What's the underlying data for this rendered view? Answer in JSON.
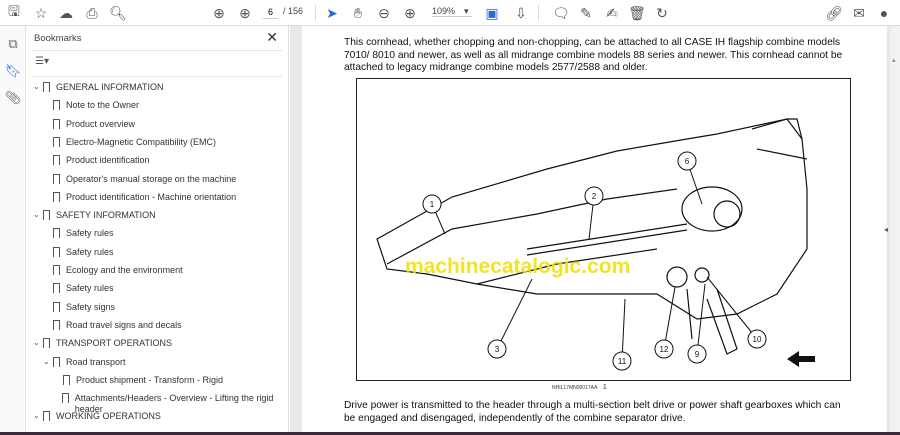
{
  "toolbar": {
    "page_current": "6",
    "page_total": "/ 156",
    "zoom": "109%",
    "icons": [
      "save-icon",
      "bookmark-star-icon",
      "upload-cloud-icon",
      "print-icon",
      "find-icon",
      "prev-page-icon",
      "next-page-icon",
      "select-cursor-icon",
      "hand-icon",
      "zoom-out-icon",
      "zoom-in-icon",
      "fit-page-icon",
      "scroll-mode-icon",
      "comment-icon",
      "highlight-icon",
      "sign-icon",
      "delete-icon",
      "rotate-icon",
      "share-link-icon",
      "email-icon",
      "account-icon"
    ]
  },
  "bookmarks": {
    "title": "Bookmarks",
    "close": "✕",
    "items": [
      {
        "label": "GENERAL INFORMATION",
        "level": 0,
        "expanded": true
      },
      {
        "label": "Note to the Owner",
        "level": 1
      },
      {
        "label": "Product overview",
        "level": 1
      },
      {
        "label": "Electro-Magnetic Compatibility (EMC)",
        "level": 1
      },
      {
        "label": "Product identification",
        "level": 1
      },
      {
        "label": "Operator's manual storage on the machine",
        "level": 1
      },
      {
        "label": "Product identification - Machine orientation",
        "level": 1
      },
      {
        "label": "SAFETY INFORMATION",
        "level": 0,
        "expanded": true
      },
      {
        "label": "Safety rules",
        "level": 1
      },
      {
        "label": "Safety rules",
        "level": 1
      },
      {
        "label": "Ecology and the environment",
        "level": 1
      },
      {
        "label": "Safety rules",
        "level": 1
      },
      {
        "label": "Safety signs",
        "level": 1
      },
      {
        "label": "Road travel signs and decals",
        "level": 1
      },
      {
        "label": "TRANSPORT OPERATIONS",
        "level": 0,
        "expanded": true
      },
      {
        "label": "Road transport",
        "level": 1,
        "expanded": true
      },
      {
        "label": "Product shipment - Transform - Rigid",
        "level": 2
      },
      {
        "label": "Attachments/Headers - Overview - Lifting the rigid header",
        "level": 2
      },
      {
        "label": "WORKING OPERATIONS",
        "level": 0,
        "expanded": true
      }
    ]
  },
  "document": {
    "para1": "This cornhead, whether chopping and non-chopping, can be attached to all CASE IH flagship combine models 7010/ 8010 and newer, as well as all midrange combine models 88 series and newer. This cornhead cannot be attached to legacy midrange combine models 2577/2588 and older.",
    "figure_callouts": [
      "1",
      "2",
      "3",
      "6",
      "9",
      "10",
      "11",
      "12"
    ],
    "figure_code": "NHIL17MN00017AA",
    "figure_number": "1",
    "watermark": "machinecatalogic.com",
    "para2": "Drive power is transmitted to the header through a multi-section belt drive or power shaft gearboxes which can be engaged and disengaged, independently of the combine separator drive."
  }
}
